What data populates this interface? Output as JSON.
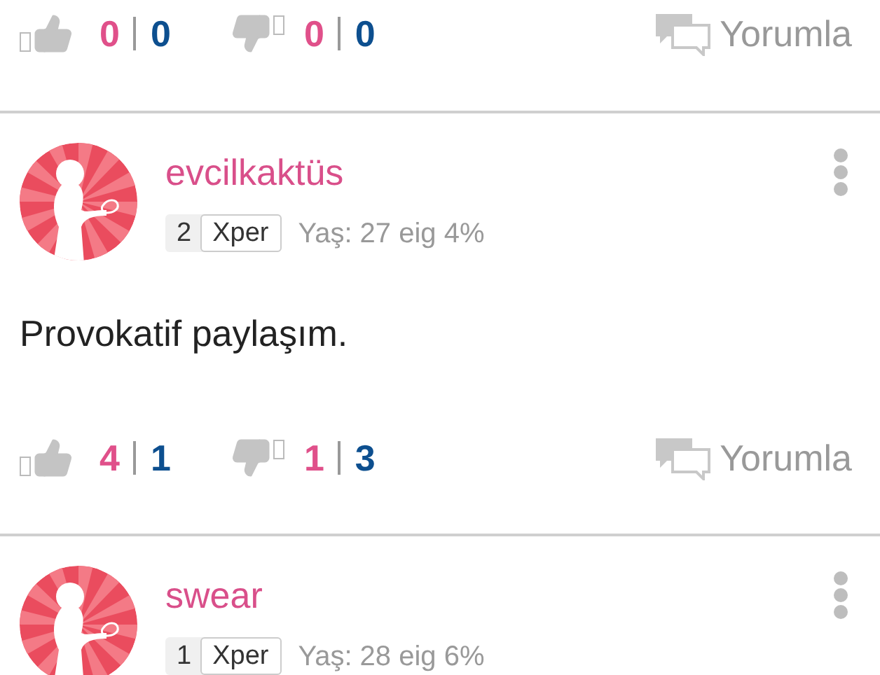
{
  "top_actions": {
    "likes": {
      "female": "0",
      "male": "0"
    },
    "dislikes": {
      "female": "0",
      "male": "0"
    },
    "comment_label": "Yorumla"
  },
  "comments": [
    {
      "username": "evcilkaktüs",
      "level": "2",
      "badge": "Xper",
      "meta": "Yaş: 27 eig 4%",
      "text": "Provokatif paylaşım.",
      "actions": {
        "likes": {
          "female": "4",
          "male": "1"
        },
        "dislikes": {
          "female": "1",
          "male": "3"
        },
        "comment_label": "Yorumla"
      }
    },
    {
      "username": "swear",
      "level": "1",
      "badge": "Xper",
      "meta": "Yaş: 28 eig 6%"
    }
  ]
}
